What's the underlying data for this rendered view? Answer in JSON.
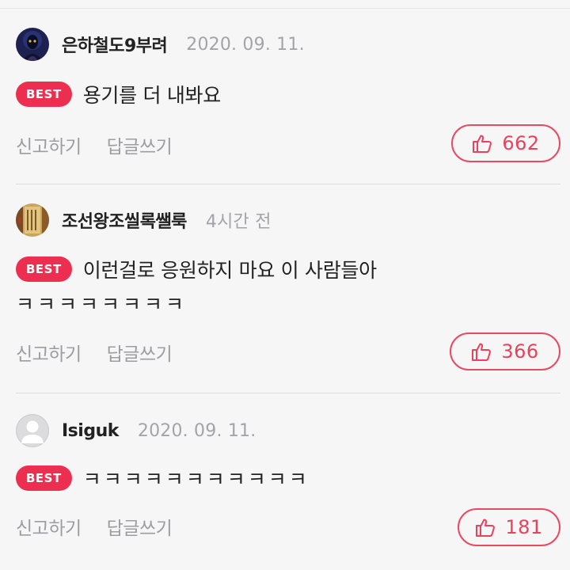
{
  "comments": [
    {
      "username": "은하철도9부려",
      "timestamp": "2020. 09. 11.",
      "badge": "BEST",
      "text": "용기를 더 내봐요",
      "text_cont": "",
      "report_label": "신고하기",
      "reply_label": "답글쓰기",
      "likes": "662",
      "avatar": "dark-figure-avatar"
    },
    {
      "username": "조선왕조씰록쌜룩",
      "timestamp": "4시간 전",
      "badge": "BEST",
      "text": "이런걸로 응원하지 마요 이 사람들아",
      "text_cont": "ㅋㅋㅋㅋㅋㅋㅋㅋ",
      "report_label": "신고하기",
      "reply_label": "답글쓰기",
      "likes": "366",
      "avatar": "scroll-avatar"
    },
    {
      "username": "Isiguk",
      "timestamp": "2020. 09. 11.",
      "badge": "BEST",
      "text": "ㅋㅋㅋㅋㅋㅋㅋㅋㅋㅋㅋ",
      "text_cont": "",
      "report_label": "신고하기",
      "reply_label": "답글쓰기",
      "likes": "181",
      "avatar": "default-user-avatar"
    }
  ],
  "colors": {
    "accent": "#ec2f50",
    "background": "#f6f6f7",
    "muted_text": "#a4a4a8",
    "like_border": "#e84a64"
  },
  "icons": {
    "like": "thumbs-up-icon"
  }
}
